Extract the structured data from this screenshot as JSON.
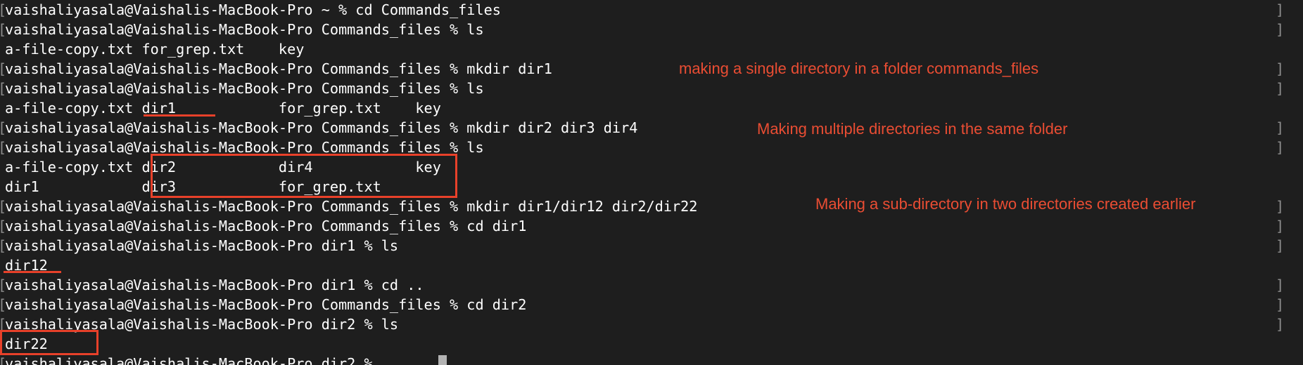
{
  "terminal": {
    "lines": [
      "vaishaliyasala@Vaishalis-MacBook-Pro ~ % cd Commands_files",
      "vaishaliyasala@Vaishalis-MacBook-Pro Commands_files % ls",
      "a-file-copy.txt for_grep.txt    key",
      "vaishaliyasala@Vaishalis-MacBook-Pro Commands_files % mkdir dir1",
      "vaishaliyasala@Vaishalis-MacBook-Pro Commands_files % ls",
      "a-file-copy.txt dir1            for_grep.txt    key",
      "vaishaliyasala@Vaishalis-MacBook-Pro Commands_files % mkdir dir2 dir3 dir4",
      "vaishaliyasala@Vaishalis-MacBook-Pro Commands_files % ls",
      "a-file-copy.txt dir2            dir4            key",
      "dir1            dir3            for_grep.txt",
      "vaishaliyasala@Vaishalis-MacBook-Pro Commands_files % mkdir dir1/dir12 dir2/dir22",
      "vaishaliyasala@Vaishalis-MacBook-Pro Commands_files % cd dir1",
      "vaishaliyasala@Vaishalis-MacBook-Pro dir1 % ls",
      "dir12",
      "vaishaliyasala@Vaishalis-MacBook-Pro dir1 % cd ..",
      "vaishaliyasala@Vaishalis-MacBook-Pro Commands_files % cd dir2",
      "vaishaliyasala@Vaishalis-MacBook-Pro dir2 % ls",
      "dir22",
      "vaishaliyasala@Vaishalis-MacBook-Pro dir2 % "
    ],
    "left_bracket": "[",
    "right_bracket": "]"
  },
  "annotations": {
    "note_mkdir_single": "making a single directory in a folder commands_files",
    "note_mkdir_multiple": "Making multiple directories in the same folder",
    "note_mkdir_sub": "Making a sub-directory in two directories created earlier"
  },
  "colors": {
    "background": "#1e1e1e",
    "text": "#ffffff",
    "annotation": "#ea4d33",
    "highlight": "#e8412a",
    "bracket": "#8c8c8c",
    "cursor": "#b3b3b3"
  }
}
